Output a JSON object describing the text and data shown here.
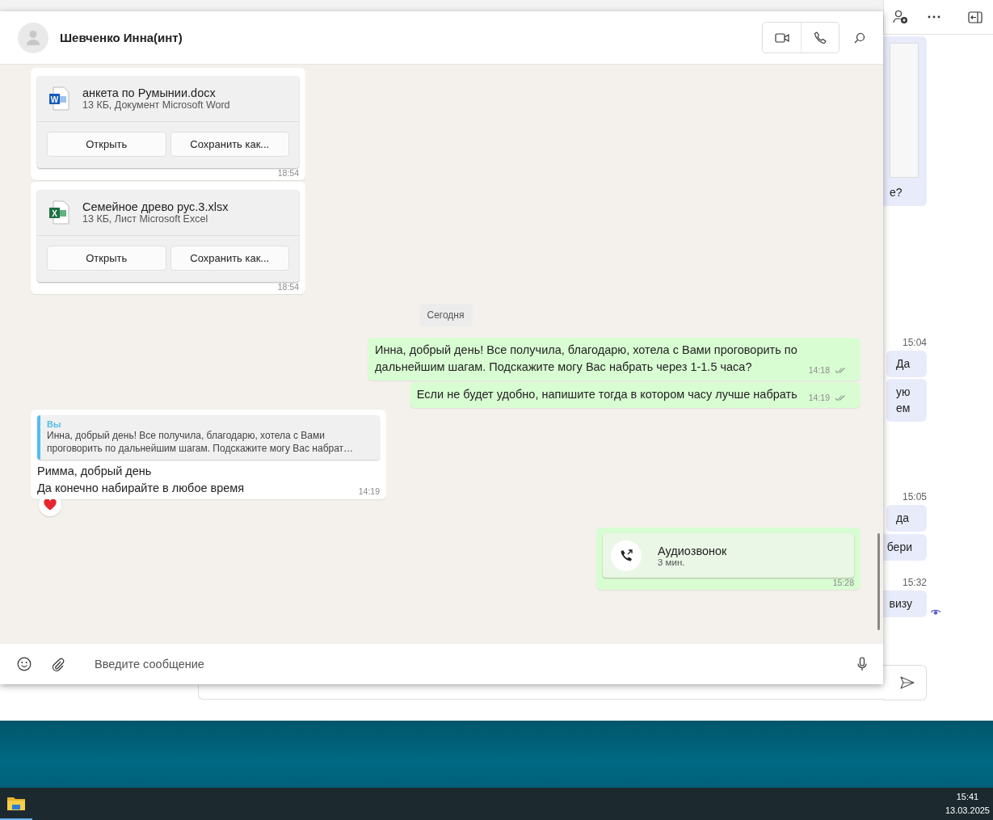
{
  "background_window": {
    "items": [
      {
        "kind": "image",
        "lines": [
          "е?"
        ],
        "seen": false
      },
      {
        "kind": "time",
        "text": "15:04"
      },
      {
        "kind": "bubble",
        "lines": [
          "Да"
        ],
        "seen": false
      },
      {
        "kind": "bubble",
        "lines": [
          "ую",
          "ем"
        ],
        "seen": false
      },
      {
        "kind": "time",
        "text": "15:05"
      },
      {
        "kind": "bubble",
        "lines": [
          "да"
        ],
        "seen": false
      },
      {
        "kind": "bubble",
        "lines": [
          "бери"
        ],
        "seen": false
      },
      {
        "kind": "time",
        "text": "15:32"
      },
      {
        "kind": "bubble",
        "lines": [
          "визу"
        ],
        "seen": true
      }
    ]
  },
  "chat": {
    "contact": "Шевченко Инна(инт)",
    "messages": [
      {
        "kind": "file",
        "outgoing": false,
        "icon": {
          "kind": "word",
          "letter": "W"
        },
        "name": "анкета по Румынии.docx",
        "details": "13 КБ, Документ Microsoft Word",
        "buttons": [
          "Открыть",
          "Сохранить как..."
        ],
        "time": "18:54"
      },
      {
        "kind": "file",
        "outgoing": false,
        "icon": {
          "kind": "excel",
          "letter": "X"
        },
        "name": "Семейное древо рус.3.xlsx",
        "details": "13 КБ, Лист Microsoft Excel",
        "buttons": [
          "Открыть",
          "Сохранить как..."
        ],
        "time": "18:54"
      },
      {
        "kind": "date",
        "text": "Сегодня"
      },
      {
        "kind": "text",
        "outgoing": true,
        "lines": [
          "Инна, добрый день! Все получила, благодарю, хотела с Вами проговорить по",
          "дальнейшим шагам. Подскажите могу Вас набрать через 1-1.5 часа?"
        ],
        "time": "14:18",
        "read": false
      },
      {
        "kind": "text",
        "outgoing": true,
        "lines": [
          "Если не будет удобно, напишите тогда в котором часу лучше набрать"
        ],
        "time": "14:19",
        "read": false
      },
      {
        "kind": "text",
        "outgoing": false,
        "quote": {
          "author": "Вы",
          "lines": [
            "Инна, добрый день! Все получила, благодарю, хотела с Вами",
            "проговорить по дальнейшим шагам. Подскажите могу Вас набрат…"
          ]
        },
        "lines": [
          "Римма, добрый день",
          "Да конечно набирайте в любое время"
        ],
        "time": "14:19",
        "hearted": true
      },
      {
        "kind": "call",
        "outgoing": true,
        "title": "Аудиозвонок",
        "duration": "3 мин.",
        "time": "15:28"
      }
    ],
    "composer": {
      "placeholder": "Введите сообщение"
    }
  },
  "taskbar": {
    "time": "15:41",
    "date": "13.03.2025"
  }
}
